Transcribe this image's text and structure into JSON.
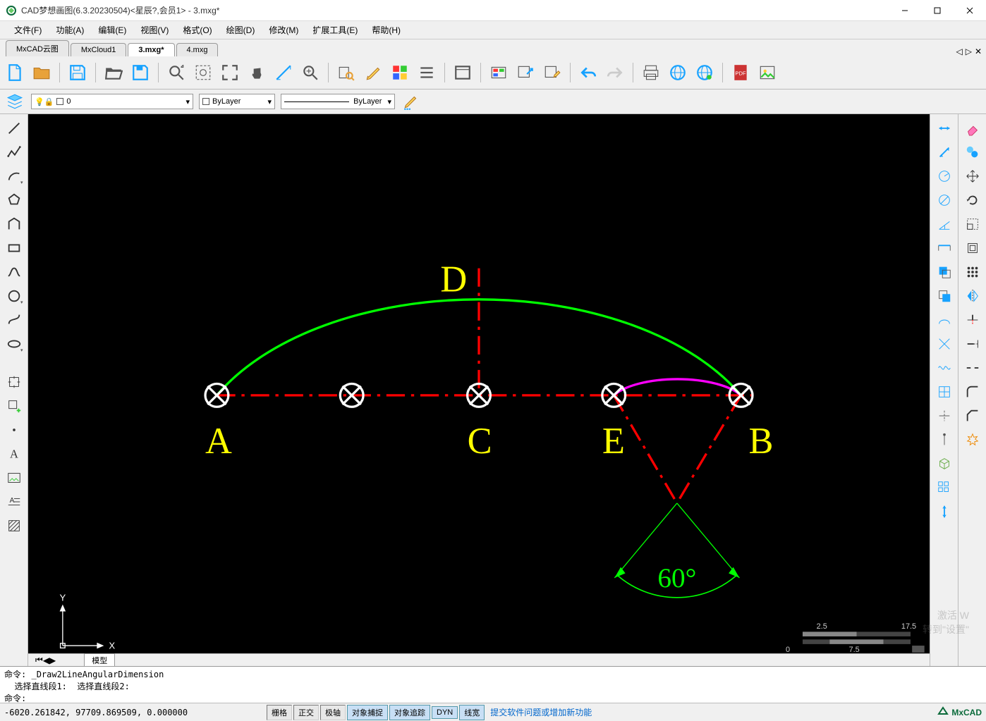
{
  "window": {
    "title": "CAD梦想画图(6.3.20230504)<星辰?,会员1> - 3.mxg*"
  },
  "menu": {
    "file": "文件(F)",
    "function": "功能(A)",
    "edit": "编辑(E)",
    "view": "视图(V)",
    "format": "格式(O)",
    "draw": "绘图(D)",
    "modify": "修改(M)",
    "ext_tools": "扩展工具(E)",
    "help": "帮助(H)"
  },
  "file_tabs": {
    "t1": "MxCAD云图",
    "t2": "MxCloud1",
    "t3": "3.mxg*",
    "t4": "4.mxg"
  },
  "layerbar": {
    "layer_value": "0",
    "color_label": "ByLayer",
    "linetype_label": "ByLayer"
  },
  "canvas": {
    "labels": {
      "A": "A",
      "B": "B",
      "C": "C",
      "D": "D",
      "E": "E"
    },
    "angle": "60°",
    "axis_x": "X",
    "axis_y": "Y",
    "scale_a": "2.5",
    "scale_b": "17.5",
    "scale_c": "0",
    "scale_d": "7.5"
  },
  "model_tab": "模型",
  "cmd": {
    "prefix": "命令:",
    "line1": "_Draw2LineAngularDimension",
    "line2": "  选择直线段1:  选择直线段2:",
    "prompt": "命令:"
  },
  "status": {
    "coords": "-6020.261842,  97709.869509,  0.000000",
    "grid": "栅格",
    "ortho": "正交",
    "polar": "极轴",
    "osnap": "对象捕捉",
    "otrack": "对象追踪",
    "dyn": "DYN",
    "lwt": "线宽",
    "feedback": "提交软件问题或增加新功能",
    "brand": "MxCAD"
  },
  "watermark": {
    "l1": "激活 W",
    "l2": "转到\"设置\""
  },
  "scrollnav": {
    "left": "◁",
    "right": "▷",
    "x": "✕"
  }
}
